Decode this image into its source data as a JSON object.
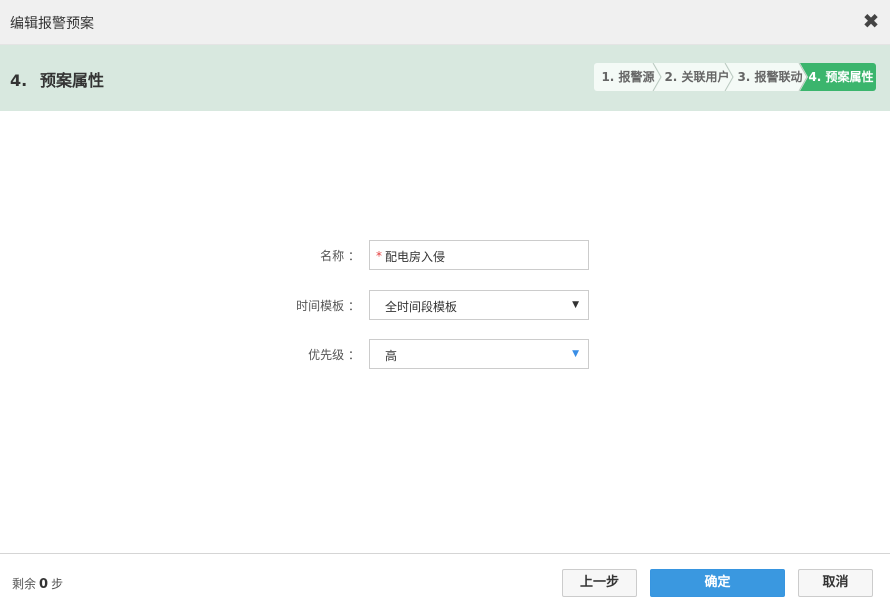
{
  "window": {
    "title": "编辑报警预案",
    "close_symbol": "✖"
  },
  "header": {
    "step_number": "4.",
    "step_title": "预案属性",
    "steps": [
      {
        "label": "1. 报警源"
      },
      {
        "label": "2. 关联用户"
      },
      {
        "label": "3. 报警联动"
      },
      {
        "label": "4. 预案属性"
      }
    ],
    "active_step": 4,
    "active_color": "#3bb56d"
  },
  "form": {
    "name": {
      "label": "名称 ：",
      "required_mark": "*",
      "value": "配电房入侵"
    },
    "time_template": {
      "label": "时间模板 ：",
      "value": "全时间段模板",
      "caret": "▼"
    },
    "priority": {
      "label": "优先级 ：",
      "value": "高",
      "caret": "▼"
    }
  },
  "footer": {
    "remain_prefix": "剩余",
    "remain_count": "0",
    "remain_suffix": "步",
    "prev_label": "上一步",
    "ok_label": "确定",
    "cancel_label": "取消",
    "ok_color": "#3a98e0"
  }
}
